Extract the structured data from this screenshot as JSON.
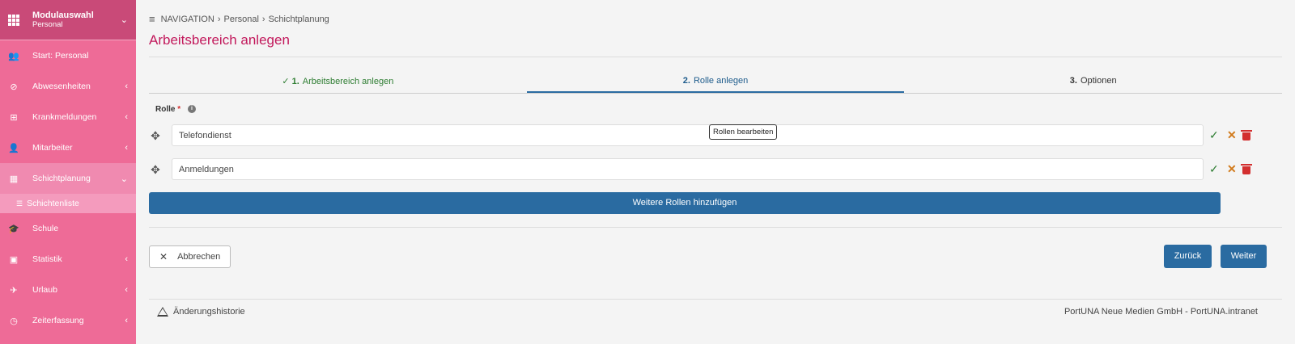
{
  "sidebar": {
    "header": {
      "title": "Modulauswahl",
      "subtitle": "Personal"
    },
    "items": [
      {
        "label": "Start: Personal",
        "icon": "users-icon"
      },
      {
        "label": "Abwesenheiten",
        "icon": "ban-icon"
      },
      {
        "label": "Krankmeldungen",
        "icon": "plus-square-icon"
      },
      {
        "label": "Mitarbeiter",
        "icon": "user-icon"
      },
      {
        "label": "Schichtplanung",
        "icon": "table-icon"
      },
      {
        "label": "Schule",
        "icon": "graduation-cap-icon"
      },
      {
        "label": "Statistik",
        "icon": "chart-icon"
      },
      {
        "label": "Urlaub",
        "icon": "plane-icon"
      },
      {
        "label": "Zeiterfassung",
        "icon": "clock-icon"
      }
    ],
    "subitem": {
      "label": "Schichtenliste"
    }
  },
  "breadcrumb": {
    "root": "NAVIGATION",
    "level1": "Personal",
    "level2": "Schichtplanung"
  },
  "page": {
    "title": "Arbeitsbereich anlegen"
  },
  "steps": [
    {
      "num": "1.",
      "label": "Arbeitsbereich anlegen",
      "state": "done"
    },
    {
      "num": "2.",
      "label": "Rolle anlegen",
      "state": "current"
    },
    {
      "num": "3.",
      "label": "Optionen",
      "state": "pending"
    }
  ],
  "form": {
    "rolle_label": "Rolle",
    "required_mark": "*",
    "roles": [
      {
        "value": "Telefondienst"
      },
      {
        "value": "Anmeldungen"
      }
    ],
    "tooltip": "Rollen bearbeiten",
    "add_button": "Weitere Rollen hinzufügen"
  },
  "actions": {
    "cancel": "Abbrechen",
    "back": "Zurück",
    "next": "Weiter"
  },
  "footer": {
    "history": "Änderungshistorie",
    "company": "PortUNA Neue Medien GmbH - PortUNA.intranet"
  },
  "colors": {
    "sidebar": "#ee6b97",
    "sidebar_header": "#c94a78",
    "primary": "#2a6ba1",
    "title": "#c2185b",
    "success": "#2e7d32",
    "danger": "#d32f2f"
  }
}
